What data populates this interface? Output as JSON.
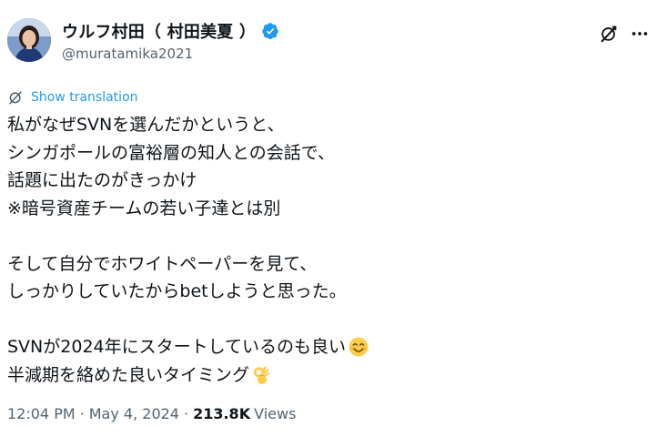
{
  "author": {
    "display_name": "ウルフ村田（ 村田美夏 ）",
    "handle": "@muratamika2021",
    "verified": true,
    "avatar_icon": "avatar-photo"
  },
  "actions": {
    "grok_icon": "grok-slash-icon",
    "more_icon": "more-dots-icon"
  },
  "translation": {
    "label": "Show translation",
    "icon": "translate-icon"
  },
  "tweet": {
    "lines": [
      "私がなぜSVNを選んだかというと、",
      "シンガポールの富裕層の知人との会話で、",
      "話題に出たのがきっかけ",
      "※暗号資産チームの若い子達とは別",
      "",
      "そして自分でホワイトペーパーを見て、",
      "しっかりしていたからbetしようと思った。",
      "",
      "SVNが2024年にスタートしているのも良い",
      "半減期を絡めた良いタイミング"
    ],
    "emoji_1": "smiling-face-with-smiling-eyes",
    "emoji_2": "ok-hand"
  },
  "meta": {
    "time": "12:04 PM",
    "separator": "·",
    "date": "May 4, 2024",
    "views_count": "213.8K",
    "views_label": "Views"
  },
  "colors": {
    "text": "#0f1419",
    "secondary": "#536471",
    "link": "#1d9bf0",
    "verified": "#1d9bf0"
  }
}
